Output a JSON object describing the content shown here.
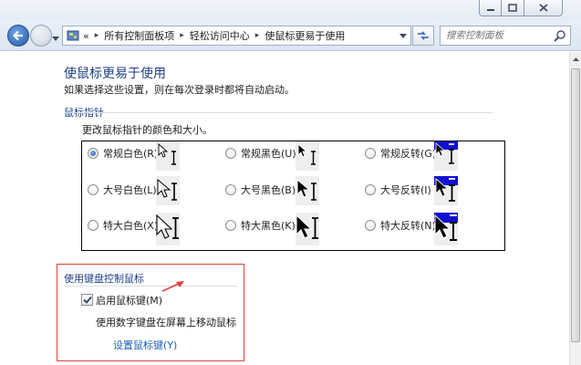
{
  "window": {
    "minimize_icon": "minimize-icon",
    "maximize_icon": "maximize-icon",
    "close_icon": "close-icon"
  },
  "address": {
    "breadcrumbs": [
      "所有控制面板项",
      "轻松访问中心",
      "使鼠标更易于使用"
    ],
    "prefix": "«",
    "search_placeholder": "搜索控制面板"
  },
  "page": {
    "title": "使鼠标更易于使用",
    "subtitle": "如果选择这些设置，则在每次登录时都将自动启动。"
  },
  "pointer_section": {
    "heading": "鼠标指针",
    "description": "更改鼠标指针的颜色和大小。",
    "schemes": [
      {
        "label": "常规白色(R)",
        "selected": true,
        "style": "white",
        "size": "normal"
      },
      {
        "label": "常规黑色(U)",
        "selected": false,
        "style": "black",
        "size": "normal"
      },
      {
        "label": "常规反转(G)",
        "selected": false,
        "style": "inverted",
        "size": "normal"
      },
      {
        "label": "大号白色(L)",
        "selected": false,
        "style": "white",
        "size": "large"
      },
      {
        "label": "大号黑色(B)",
        "selected": false,
        "style": "black",
        "size": "large"
      },
      {
        "label": "大号反转(I)",
        "selected": false,
        "style": "inverted",
        "size": "large"
      },
      {
        "label": "特大白色(X)",
        "selected": false,
        "style": "white",
        "size": "xlarge"
      },
      {
        "label": "特大黑色(K)",
        "selected": false,
        "style": "black",
        "size": "xlarge"
      },
      {
        "label": "特大反转(N)",
        "selected": false,
        "style": "inverted",
        "size": "xlarge"
      }
    ]
  },
  "keyboard_section": {
    "heading": "使用键盘控制鼠标",
    "mouse_keys_label": "启用鼠标键(M)",
    "mouse_keys_checked": true,
    "mouse_keys_desc": "使用数字键盘在屏幕上移动鼠标",
    "setup_link": "设置鼠标键(Y)"
  },
  "colors": {
    "heading": "#1e3f87",
    "link": "#1c5fb3",
    "highlight_box": "#e0413d",
    "inverted_bg": "#1010d0"
  }
}
